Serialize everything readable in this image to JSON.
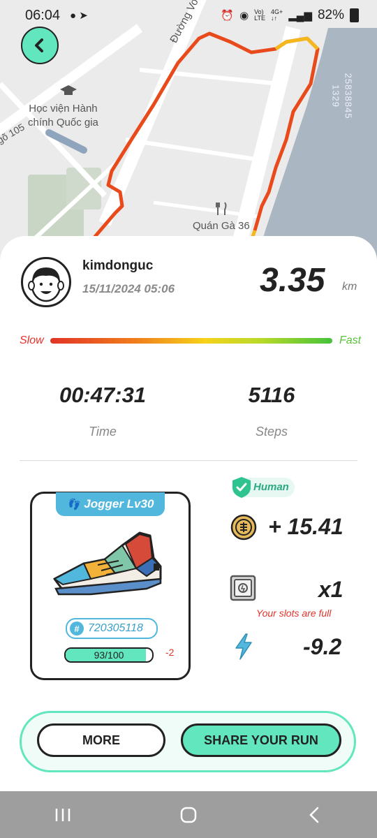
{
  "status_bar": {
    "time": "06:04",
    "battery": "82%"
  },
  "map": {
    "labels": {
      "academy": "Học viện Hành\nchính Quốc gia",
      "street_top": "Đường Vo",
      "alley": "gõ 105",
      "restaurant": "Quán Gà 36",
      "vertical_code": "25838845 1329"
    }
  },
  "run": {
    "username": "kimdonguc",
    "datetime": "15/11/2024 05:06",
    "distance": "3.35",
    "distance_unit": "km"
  },
  "speed_legend": {
    "slow": "Slow",
    "fast": "Fast"
  },
  "stats": {
    "time_value": "00:47:31",
    "time_label": "Time",
    "steps_value": "5116",
    "steps_label": "Steps"
  },
  "shoe": {
    "title": "Jogger Lv30",
    "id": "720305118",
    "durability_text": "93/100",
    "durability_fraction": 0.93,
    "durability_delta": "-2"
  },
  "rewards": {
    "badge": "Human",
    "token_value": "+ 15.41",
    "mystery_box_value": "x1",
    "slots_message": "Your slots are full",
    "energy_value": "-9.2"
  },
  "buttons": {
    "more": "MORE",
    "share": "SHARE YOUR RUN"
  },
  "colors": {
    "accent": "#62e6bd",
    "shoe_blue": "#52b7dc",
    "warning_red": "#e0332b",
    "fast_green": "#5ac03a"
  },
  "icons": {
    "back": "chevron-left-icon",
    "token": "coin-icon",
    "mystery_box": "mystery-box-icon",
    "energy": "lightning-icon",
    "footprints": "footprints-icon",
    "verified": "shield-check-icon"
  }
}
